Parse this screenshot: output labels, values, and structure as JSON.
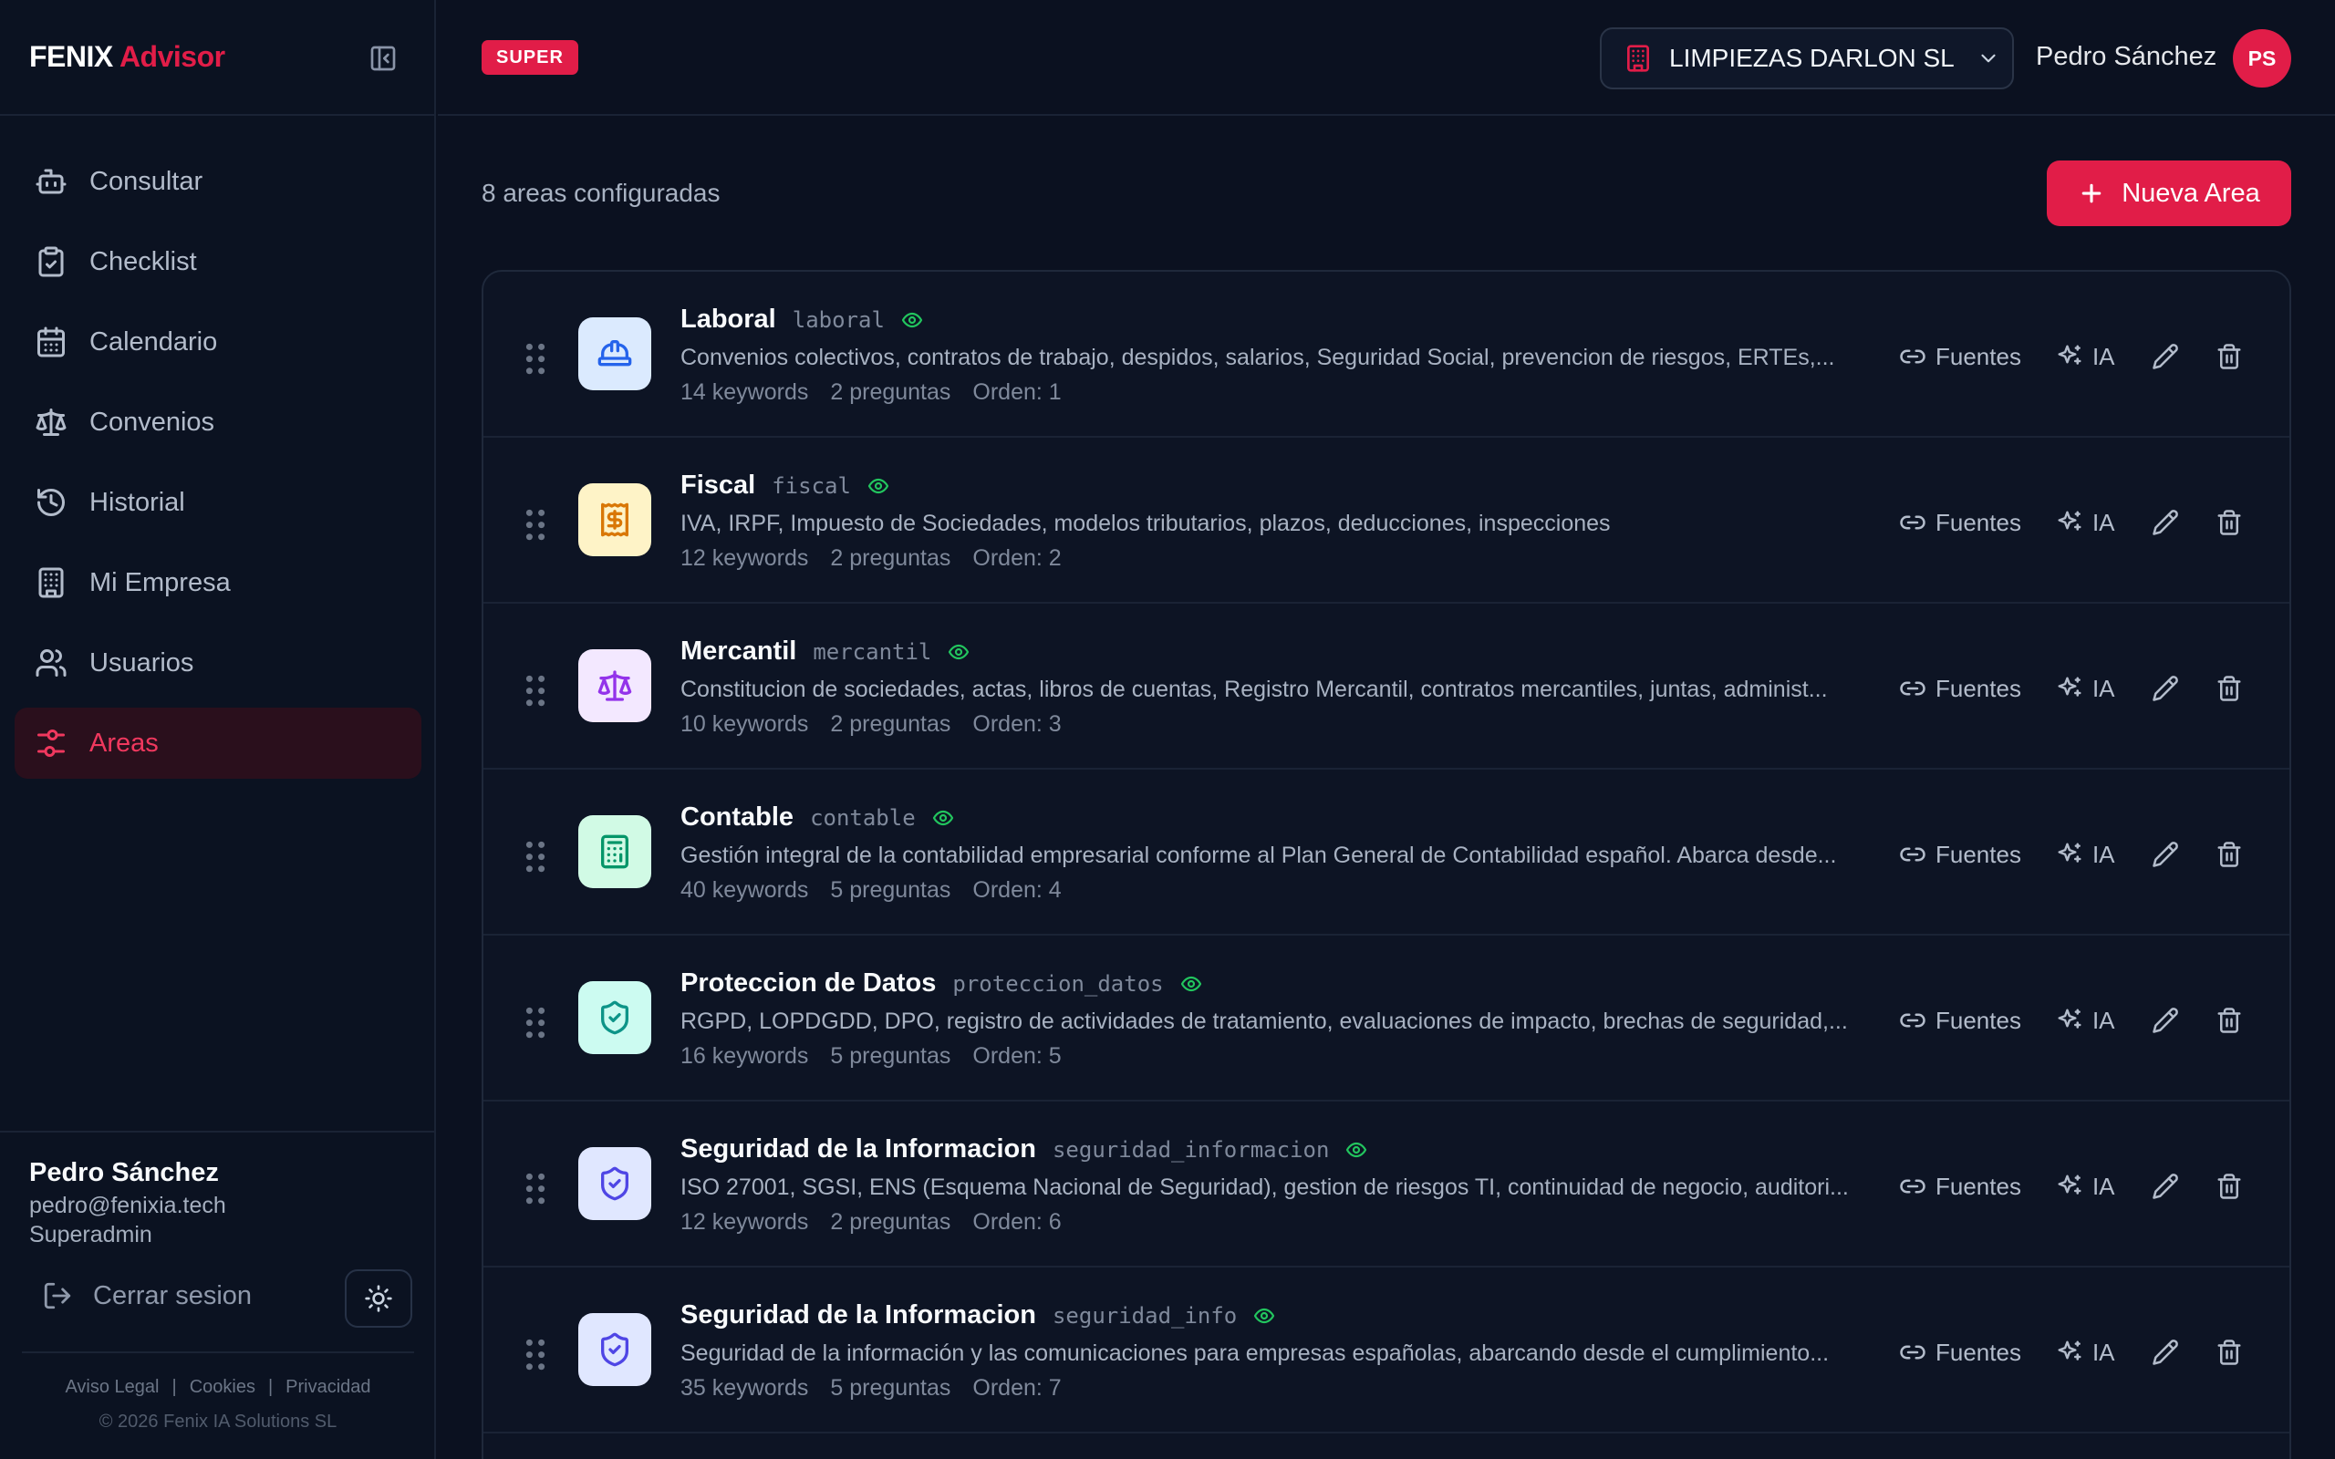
{
  "app": {
    "brand_white": "FENIX",
    "brand_red": "Advisor"
  },
  "nav": [
    {
      "label": "Consultar",
      "icon": "robot-icon",
      "active": false
    },
    {
      "label": "Checklist",
      "icon": "clipboard-check-icon",
      "active": false
    },
    {
      "label": "Calendario",
      "icon": "calendar-icon",
      "active": false
    },
    {
      "label": "Convenios",
      "icon": "scale-icon",
      "active": false
    },
    {
      "label": "Historial",
      "icon": "history-icon",
      "active": false
    },
    {
      "label": "Mi Empresa",
      "icon": "building-icon",
      "active": false
    },
    {
      "label": "Usuarios",
      "icon": "users-icon",
      "active": false
    },
    {
      "label": "Areas",
      "icon": "sliders-icon",
      "active": true
    }
  ],
  "user": {
    "name": "Pedro Sánchez",
    "email": "pedro@fenixia.tech",
    "role": "Superadmin",
    "initials": "PS"
  },
  "footer": {
    "logout": "Cerrar sesion",
    "links": [
      "Aviso Legal",
      "Cookies",
      "Privacidad"
    ],
    "copyright": "© 2026 Fenix IA Solutions SL"
  },
  "topbar": {
    "badge": "SUPER",
    "company": "LIMPIEZAS DARLON SL"
  },
  "main": {
    "count_text": "8 areas configuradas",
    "new_button": "Nueva Area"
  },
  "actions": {
    "fuentes": "Fuentes",
    "ia": "IA"
  },
  "colors": {
    "accent": "#e11d48",
    "visible": "#22c55e",
    "background": "#0b1120"
  },
  "areas": [
    {
      "name": "Laboral",
      "slug": "laboral",
      "description": "Convenios colectivos, contratos de trabajo, despidos, salarios, Seguridad Social, prevencion de riesgos, ERTEs,...",
      "keywords": "14 keywords",
      "preguntas": "2 preguntas",
      "orden": "Orden: 1",
      "icon": "hard-hat-icon",
      "icon_bg": "#dbeafe",
      "icon_color": "#2563eb"
    },
    {
      "name": "Fiscal",
      "slug": "fiscal",
      "description": "IVA, IRPF, Impuesto de Sociedades, modelos tributarios, plazos, deducciones, inspecciones",
      "keywords": "12 keywords",
      "preguntas": "2 preguntas",
      "orden": "Orden: 2",
      "icon": "receipt-icon",
      "icon_bg": "#fef3c7",
      "icon_color": "#d97706"
    },
    {
      "name": "Mercantil",
      "slug": "mercantil",
      "description": "Constitucion de sociedades, actas, libros de cuentas, Registro Mercantil, contratos mercantiles, juntas, administ...",
      "keywords": "10 keywords",
      "preguntas": "2 preguntas",
      "orden": "Orden: 3",
      "icon": "scale-icon",
      "icon_bg": "#f3e8ff",
      "icon_color": "#9333ea"
    },
    {
      "name": "Contable",
      "slug": "contable",
      "description": "Gestión integral de la contabilidad empresarial conforme al Plan General de Contabilidad español. Abarca desde...",
      "keywords": "40 keywords",
      "preguntas": "5 preguntas",
      "orden": "Orden: 4",
      "icon": "calculator-icon",
      "icon_bg": "#d1fae5",
      "icon_color": "#059669"
    },
    {
      "name": "Proteccion de Datos",
      "slug": "proteccion_datos",
      "description": "RGPD, LOPDGDD, DPO, registro de actividades de tratamiento, evaluaciones de impacto, brechas de seguridad,...",
      "keywords": "16 keywords",
      "preguntas": "5 preguntas",
      "orden": "Orden: 5",
      "icon": "shield-check-icon",
      "icon_bg": "#ccfbf1",
      "icon_color": "#0d9488"
    },
    {
      "name": "Seguridad de la Informacion",
      "slug": "seguridad_informacion",
      "description": "ISO 27001, SGSI, ENS (Esquema Nacional de Seguridad), gestion de riesgos TI, continuidad de negocio, auditori...",
      "keywords": "12 keywords",
      "preguntas": "2 preguntas",
      "orden": "Orden: 6",
      "icon": "shield-check-icon",
      "icon_bg": "#e0e7ff",
      "icon_color": "#4f46e5"
    },
    {
      "name": "Seguridad de la Informacion",
      "slug": "seguridad_info",
      "description": "Seguridad de la información y las comunicaciones para empresas españolas, abarcando desde el cumplimiento...",
      "keywords": "35 keywords",
      "preguntas": "5 preguntas",
      "orden": "Orden: 7",
      "icon": "shield-check-icon",
      "icon_bg": "#e0e7ff",
      "icon_color": "#4f46e5"
    }
  ]
}
